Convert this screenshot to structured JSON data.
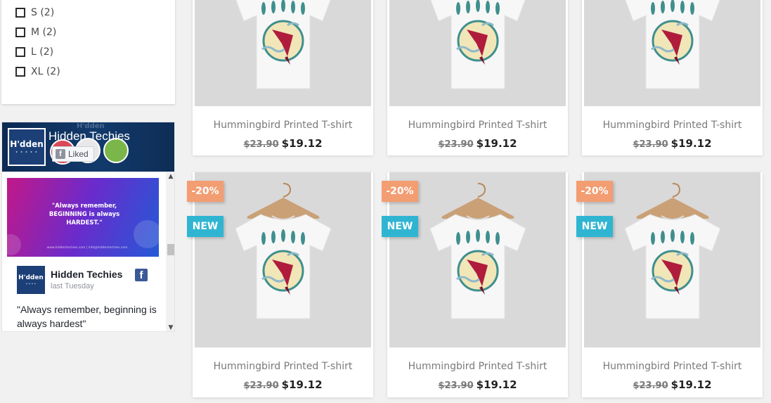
{
  "filters": {
    "sizes": [
      {
        "label": "S (2)"
      },
      {
        "label": "M (2)"
      },
      {
        "label": "L (2)"
      },
      {
        "label": "XL (2)"
      }
    ]
  },
  "facebook": {
    "page_name": "Hidden Techies",
    "cover_ghost_text": "H'dden",
    "logo_text": "H'dden",
    "liked_label": "Liked",
    "post": {
      "image_quote": "\"Always remember, BEGINNING is always HARDEST.\"",
      "image_footer": "www.hiddentechies.com  |  info@hiddentechies.com",
      "author": "Hidden Techies",
      "time": "last Tuesday",
      "text": "\"Always remember, beginning is always hardest\""
    }
  },
  "products": [
    {
      "name": "Hummingbird Printed T-shirt",
      "old_price": "$23.90",
      "price": "$19.12"
    },
    {
      "name": "Hummingbird Printed T-shirt",
      "old_price": "$23.90",
      "price": "$19.12"
    },
    {
      "name": "Hummingbird Printed T-shirt",
      "old_price": "$23.90",
      "price": "$19.12"
    },
    {
      "name": "Hummingbird Printed T-shirt",
      "old_price": "$23.90",
      "price": "$19.12",
      "discount": "-20%",
      "flag": "NEW"
    },
    {
      "name": "Hummingbird Printed T-shirt",
      "old_price": "$23.90",
      "price": "$19.12",
      "discount": "-20%",
      "flag": "NEW"
    },
    {
      "name": "Hummingbird Printed T-shirt",
      "old_price": "$23.90",
      "price": "$19.12",
      "discount": "-20%",
      "flag": "NEW"
    }
  ],
  "colors": {
    "discount_badge": "#f39d72",
    "new_badge": "#2fb5d2",
    "facebook_blue": "#3b5998"
  }
}
